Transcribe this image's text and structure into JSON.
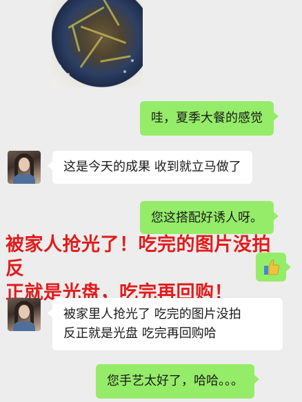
{
  "messages": {
    "m1": {
      "text": "哇，夏季大餐的感觉"
    },
    "m2": {
      "text": "这是今天的成果 收到就立马做了"
    },
    "m3": {
      "text": "您这搭配好诱人呀。"
    },
    "m4": {
      "line1": "被家里人抢光了  吃完的图片没拍",
      "line2": "反正就是光盘 吃完再回购哈"
    },
    "m5": {
      "text": "您手艺太好了，哈哈。。。"
    }
  },
  "overlay": {
    "line1": "被家人抢光了！吃完的图片没拍反",
    "line2": "正就是光盘，吃完再回购！"
  },
  "emoji": {
    "icon": "thumbs-up-icon"
  },
  "colors": {
    "background": "#ededed",
    "outgoing_bubble": "#95ec69",
    "incoming_bubble": "#ffffff",
    "overlay_text": "#e11b1b"
  }
}
